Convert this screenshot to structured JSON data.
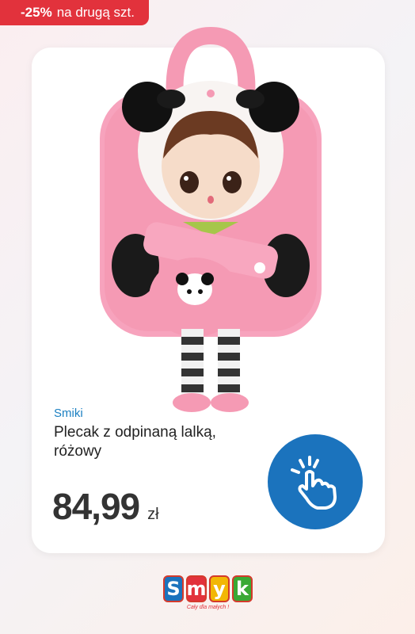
{
  "promo": {
    "percent": "-25%",
    "text": "na drugą szt."
  },
  "product": {
    "brand": "Smiki",
    "name": "Plecak z odpinaną lalką, różowy",
    "price": "84,99",
    "currency": "zł"
  },
  "tap_button": {
    "icon": "tap-hand-icon"
  },
  "logo": {
    "letters": [
      "S",
      "m",
      "y",
      "k"
    ],
    "tagline": "Cały dla małych !",
    "colors": [
      "#1b73bd",
      "#e2323c",
      "#f2b705",
      "#3aa935"
    ]
  },
  "colors": {
    "accent_red": "#e2323c",
    "brand_blue": "#1b73bd",
    "bag_pink": "#f59ab4"
  }
}
